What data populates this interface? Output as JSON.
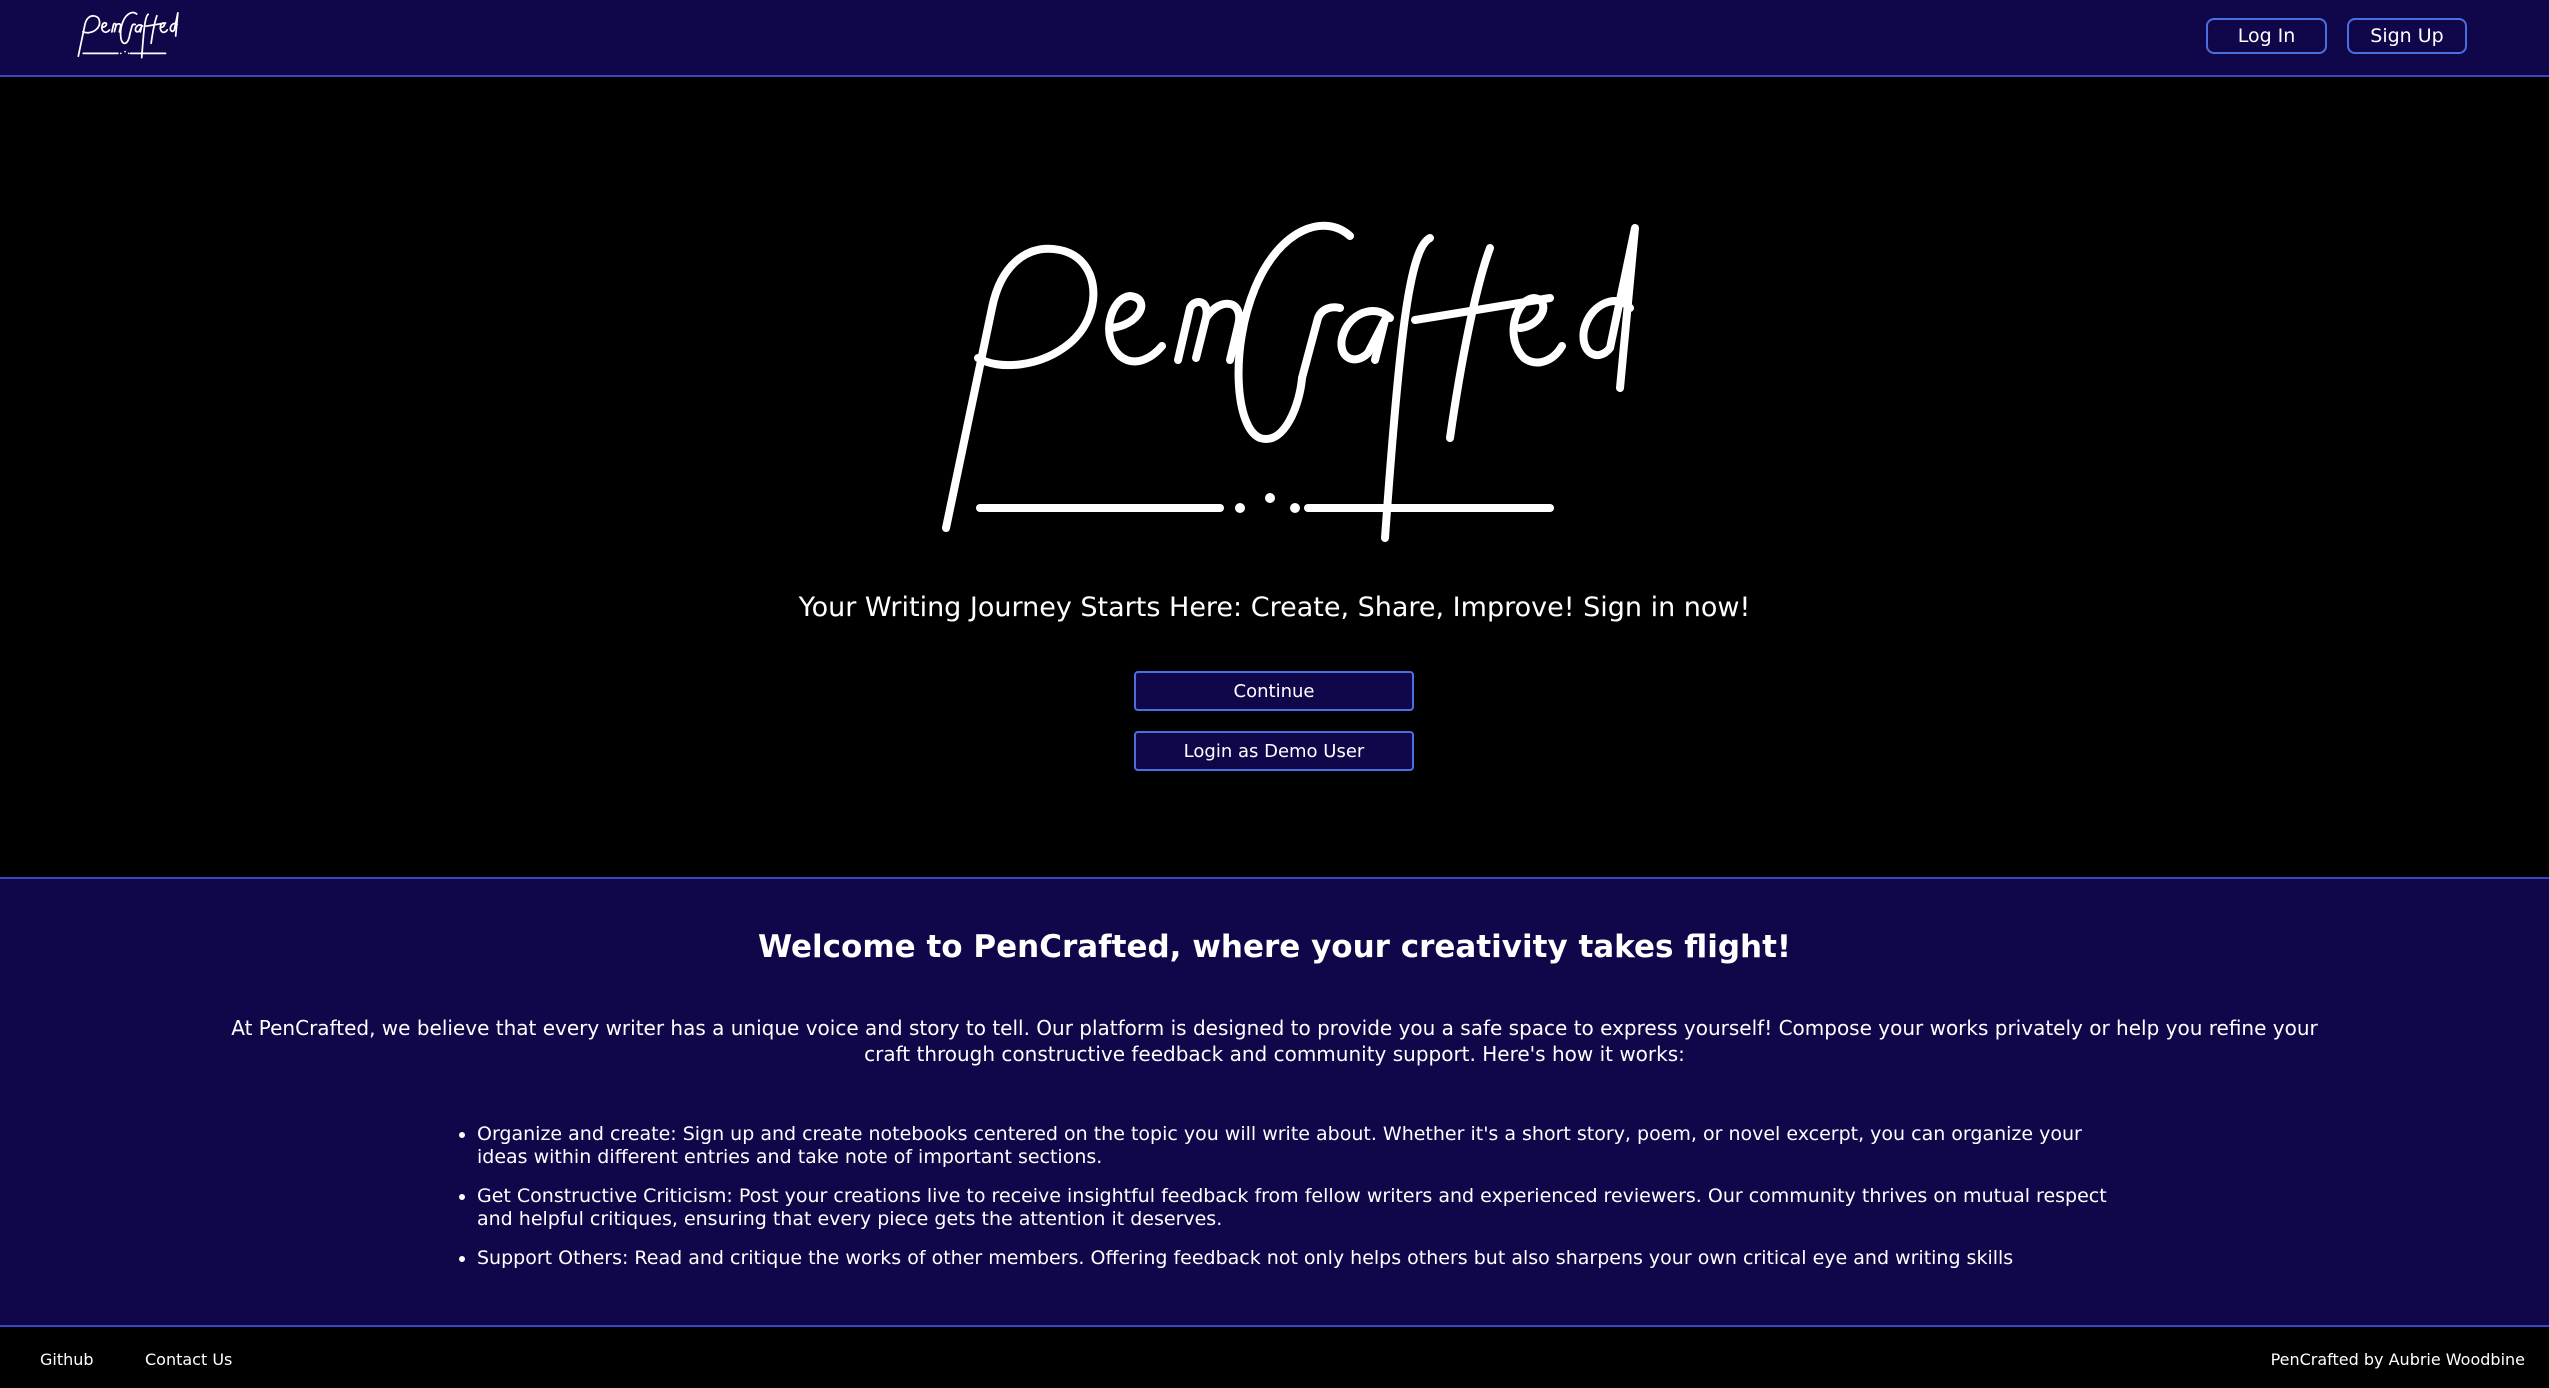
{
  "brand": {
    "name": "PenCrafted"
  },
  "navbar": {
    "login_label": "Log In",
    "signup_label": "Sign Up"
  },
  "hero": {
    "tagline": "Your Writing Journey Starts Here: Create, Share, Improve! Sign in now!",
    "continue_label": "Continue",
    "demo_label": "Login as Demo User"
  },
  "info": {
    "title": "Welcome to PenCrafted, where your creativity takes flight!",
    "intro": "At PenCrafted, we believe that every writer has a unique voice and story to tell. Our platform is designed to provide you a safe space to express yourself! Compose your works privately or help you refine your craft through constructive feedback and community support. Here's how it works:",
    "items": [
      "Organize and create: Sign up and create notebooks centered on the topic you will write about. Whether it's a short story, poem, or novel excerpt, you can organize your ideas within different entries and take note of important sections.",
      "Get Constructive Criticism: Post your creations live to receive insightful feedback from fellow writers and experienced reviewers. Our community thrives on mutual respect and helpful critiques, ensuring that every piece gets the attention it deserves.",
      "Support Others: Read and critique the works of other members. Offering feedback not only helps others but also sharpens your own critical eye and writing skills"
    ]
  },
  "footer": {
    "github_label": "Github",
    "contact_label": "Contact Us",
    "credit": "PenCrafted by Aubrie Woodbine"
  },
  "colors": {
    "navy": "#10064a",
    "accent_border": "#4a6fe0",
    "background": "#000000",
    "text": "#ffffff"
  }
}
